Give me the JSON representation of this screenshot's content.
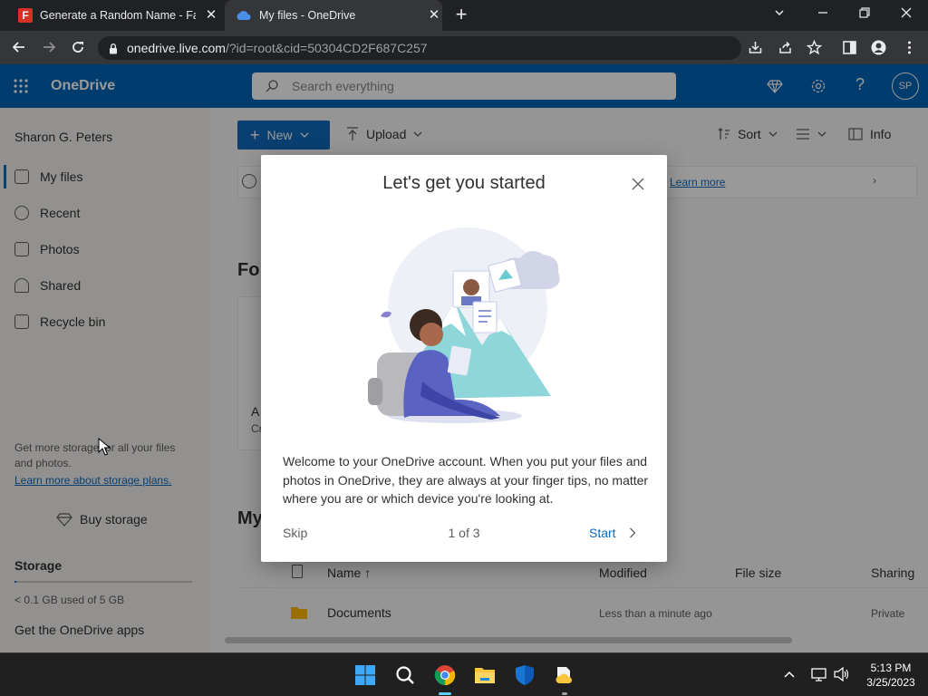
{
  "browser": {
    "tabs": [
      {
        "title": "Generate a Random Name - Fake",
        "favicon": "fakename-favicon-icon",
        "active": false
      },
      {
        "title": "My files - OneDrive",
        "favicon": "onedrive-cloud-icon",
        "active": true
      }
    ],
    "url_host": "onedrive.live.com",
    "url_path": "/?id=root&cid=50304CD2F687C257"
  },
  "suite": {
    "app_name": "OneDrive",
    "search_placeholder": "Search everything",
    "avatar_initials": "SP"
  },
  "sidebar": {
    "user_name": "Sharon G. Peters",
    "items": [
      {
        "label": "My files",
        "icon": "folder-icon",
        "selected": true
      },
      {
        "label": "Recent",
        "icon": "clock-icon"
      },
      {
        "label": "Photos",
        "icon": "image-icon"
      },
      {
        "label": "Shared",
        "icon": "people-icon"
      },
      {
        "label": "Recycle bin",
        "icon": "trash-icon"
      }
    ],
    "promo_text_1": "Get more storage for all your files",
    "promo_text_2": "and photos.",
    "promo_link": "Learn more about storage plans.",
    "buy_storage": "Buy storage",
    "storage_heading": "Storage",
    "storage_used": "< 0.1 GB used of 5 GB",
    "storage_fraction": 0.01,
    "get_apps": "Get the OneDrive apps"
  },
  "commandbar": {
    "new_label": "New",
    "upload_label": "Upload",
    "sort_label": "Sort",
    "info_label": "Info"
  },
  "content": {
    "banner_link": "Learn more",
    "for_you_heading": "Fo",
    "card_letter_1": "A",
    "card_letter_2": "Cr",
    "my_files_heading": "My",
    "columns": {
      "name": "Name ↑",
      "modified": "Modified",
      "size": "File size",
      "sharing": "Sharing"
    },
    "rows": [
      {
        "name": "Documents",
        "modified": "Less than a minute ago",
        "sharing": "Private"
      }
    ]
  },
  "dialog": {
    "title": "Let's get you started",
    "body": "Welcome to your OneDrive account. When you put your files and photos in OneDrive, they are always at your finger tips, no matter where you are or which device you're looking at.",
    "skip": "Skip",
    "page_indicator": "1 of 3",
    "start": "Start"
  },
  "taskbar": {
    "time": "5:13 PM",
    "date": "3/25/2023"
  },
  "colors": {
    "suite_blue": "#0364b8",
    "link_blue": "#0f6cbd",
    "new_button": "#0f6cbd"
  }
}
